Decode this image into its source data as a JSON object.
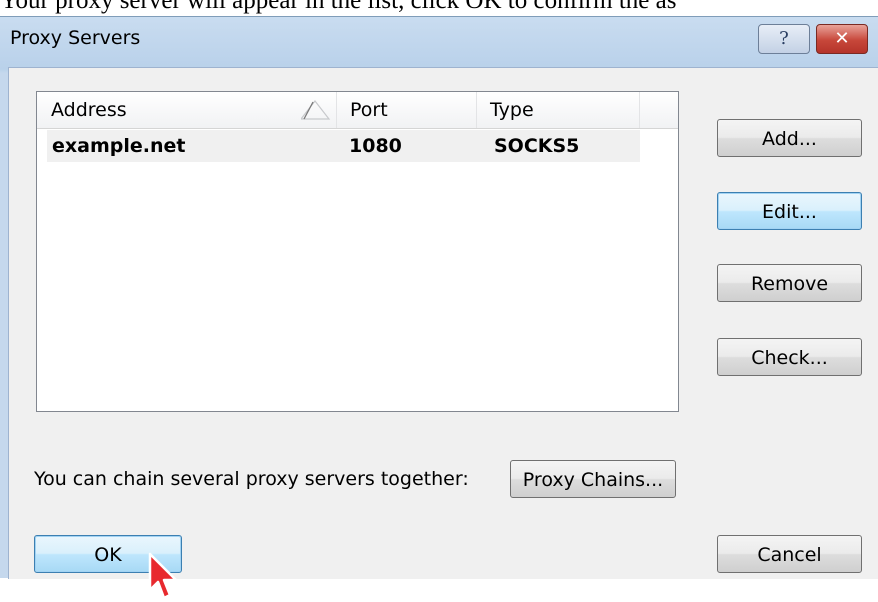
{
  "doc_caption": "Your proxy server will appear in the list, click OK to confirm the as",
  "window": {
    "title": "Proxy Servers",
    "help_glyph": "?",
    "close_glyph": "✕"
  },
  "list": {
    "columns": [
      "Address",
      "Port",
      "Type"
    ],
    "rows": [
      {
        "address": "example.net",
        "port": "1080",
        "type": "SOCKS5"
      }
    ]
  },
  "side_buttons": {
    "add": "Add...",
    "edit": "Edit...",
    "remove": "Remove",
    "check": "Check..."
  },
  "chain": {
    "label": "You can chain several proxy servers together:",
    "button": "Proxy Chains..."
  },
  "footer": {
    "ok": "OK",
    "cancel": "Cancel"
  },
  "colors": {
    "title_bar": "#b9d1ea",
    "close_button": "#c7473a",
    "focused_button": "#bee6fd",
    "selection_row": "#f0f0f0"
  }
}
